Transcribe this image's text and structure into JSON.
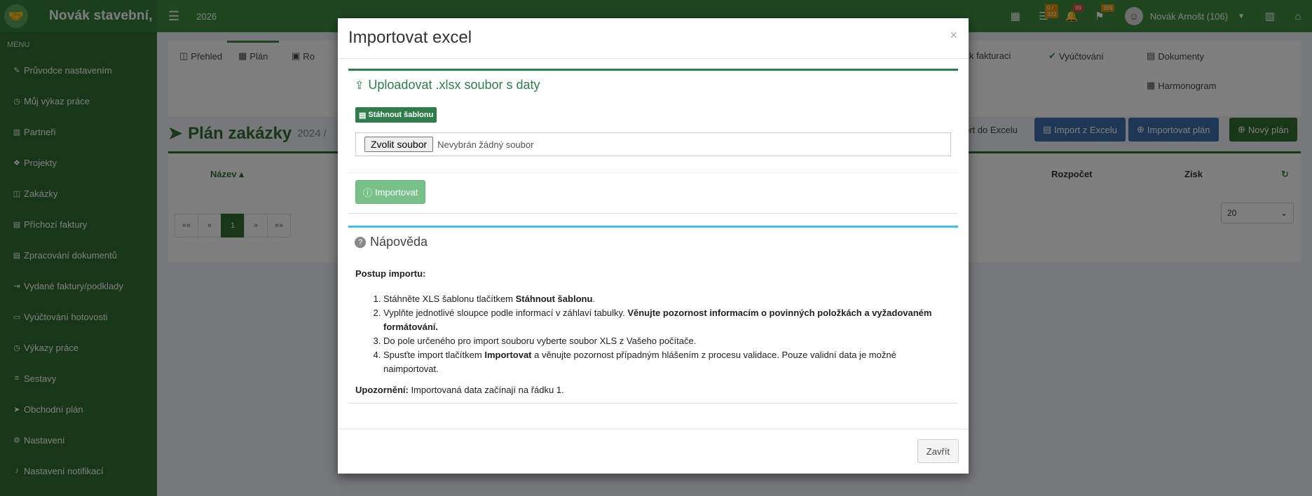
{
  "app": {
    "brand": "Novák stavební,",
    "year": "2026",
    "badges": {
      "tasks": "0 / 333",
      "alerts": "99",
      "messages": "399"
    },
    "user": "Novák Arnošt (106)"
  },
  "sidebar": {
    "header": "MENU",
    "items": [
      {
        "label": "Průvodce nastavením"
      },
      {
        "label": "Můj výkaz práce"
      },
      {
        "label": "Partneři"
      },
      {
        "label": "Projekty"
      },
      {
        "label": "Zakázky"
      },
      {
        "label": "Příchozí faktury"
      },
      {
        "label": "Zpracování dokumentů"
      },
      {
        "label": "Vydané faktury/podklady"
      },
      {
        "label": "Vyúčtování hotovosti"
      },
      {
        "label": "Výkazy práce"
      },
      {
        "label": "Sestavy"
      },
      {
        "label": "Obchodní plán"
      },
      {
        "label": "Nastavení"
      },
      {
        "label": "Nastavení notifikací"
      }
    ]
  },
  "tabs": {
    "prehled": "Přehled",
    "plan": "Plán",
    "rozpocet": "Ro",
    "fakturaci": "ly k fakturaci",
    "vyuctovani": "Vyúčtování",
    "dokumenty": "Dokumenty",
    "harmonogram": "Harmonogram"
  },
  "page": {
    "title": "Plán zakázky",
    "subtitle": "2024 /"
  },
  "toolbar": {
    "export_label": "ort do Excelu",
    "import_excel_label": "Import z Excelu",
    "import_plan_label": "Importovat plán",
    "new_plan_label": "Nový plán"
  },
  "table": {
    "col_name": "Název",
    "col_budget": "Rozpočet",
    "col_profit": "Zisk",
    "pager": [
      "««",
      "«",
      "1",
      "»",
      "»»"
    ],
    "page_size": "20"
  },
  "modal": {
    "title": "Importovat excel",
    "close_symbol": "×",
    "upload_header": "Uploadovat .xlsx soubor s daty",
    "download_template": "Stáhnout šablonu",
    "file_button": "Zvolit soubor",
    "file_none": "Nevybrán žádný soubor",
    "import_button": "Importovat",
    "help_header": "Nápověda",
    "help_intro": "Postup importu:",
    "step1_a": "Stáhněte XLS šablonu tlačítkem ",
    "step1_b": "Stáhnout šablonu",
    "step1_c": ".",
    "step2_a": "Vyplňte jednotlivé sloupce podle informací v záhlaví tabulky. ",
    "step2_b": "Věnujte pozornost informacím o povinných položkách a vyžadovaném formátování.",
    "step3": "Do pole určeného pro import souboru vyberte soubor XLS z Vašeho počítače.",
    "step4_a": "Spusťte import tlačítkem ",
    "step4_b": "Importovat",
    "step4_c": " a věnujte pozornost případným hlášením z procesu validace. Pouze validní data je možné naimportovat.",
    "warning_label": "Upozornění:",
    "warning_text": " Importovaná data začínají na řádku 1.",
    "close_button": "Zavřít"
  },
  "colors": {
    "brand_green": "#3c8d3f",
    "dark_green": "#2f6f31",
    "upload_accent": "#2f7d4b",
    "help_accent": "#3cc3e6",
    "import_blue": "#3c6fa9"
  }
}
